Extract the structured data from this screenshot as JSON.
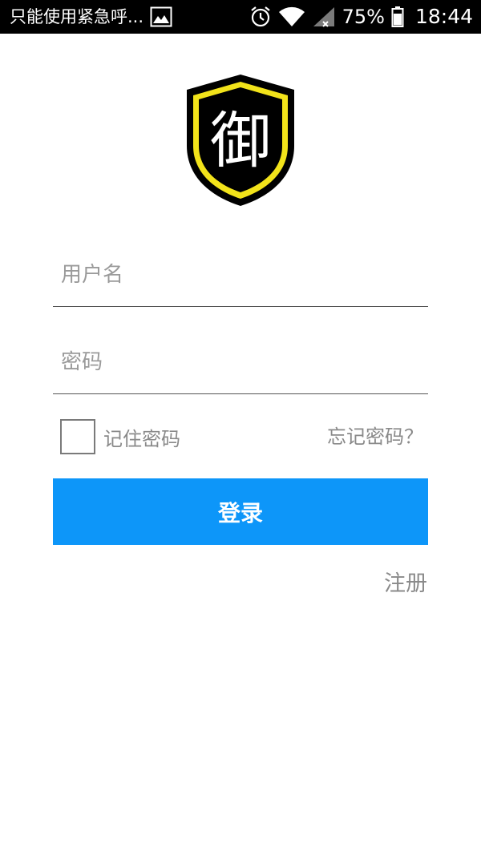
{
  "status_bar": {
    "notification_text": "只能使用紧急呼...",
    "notification_icon": "image-icon",
    "battery_percent": "75%",
    "time": "18:44",
    "icons": [
      "alarm-icon",
      "wifi-icon",
      "signal-icon",
      "battery-icon"
    ]
  },
  "logo": {
    "glyph": "御",
    "icon": "shield-logo-icon",
    "colors": {
      "outer": "#000000",
      "ring": "#f2e31a",
      "inner": "#000000",
      "glyph": "#ffffff"
    }
  },
  "login_form": {
    "username_placeholder": "用户名",
    "username_value": "",
    "password_placeholder": "密码",
    "password_value": "",
    "remember_label": "记住密码",
    "remember_checked": false,
    "forgot_label": "忘记密码？",
    "login_label": "登录",
    "register_label": "注册"
  },
  "colors": {
    "accent": "#0d96f9",
    "secondary_text": "#8a8a8a",
    "status_bar": "#000000"
  }
}
